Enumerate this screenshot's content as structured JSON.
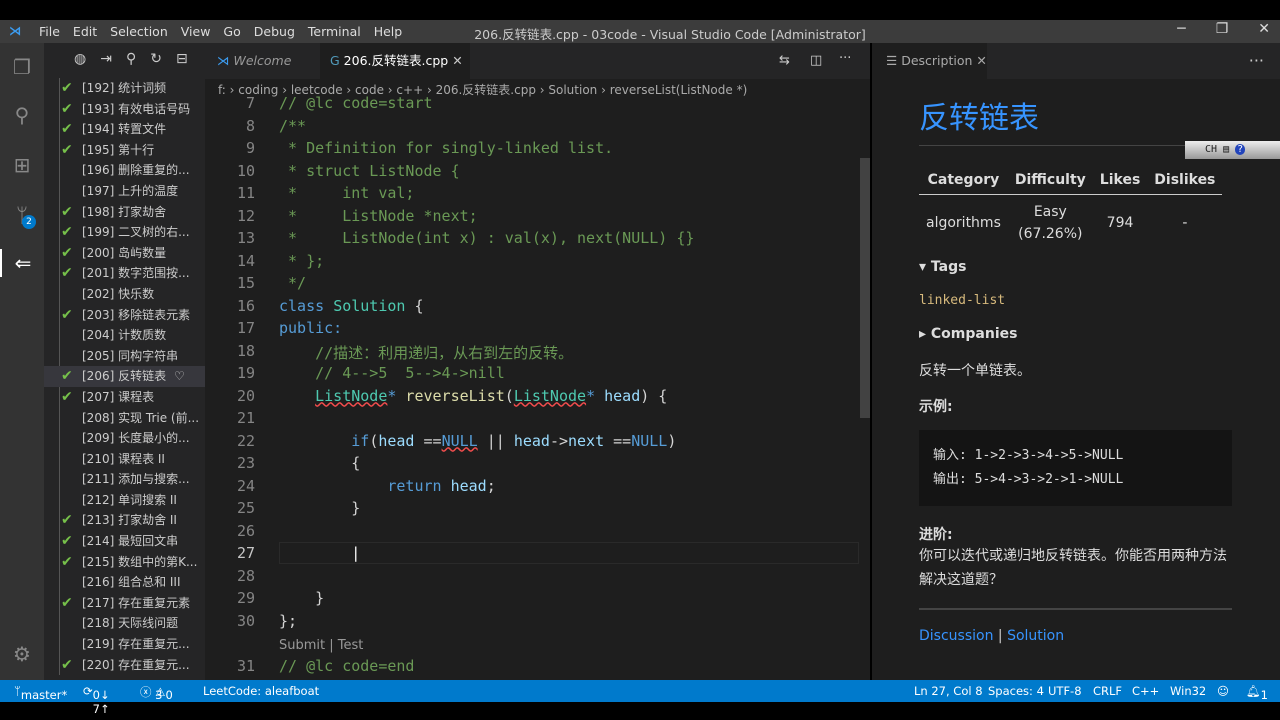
{
  "window": {
    "title": "206.反转链表.cpp - 03code - Visual Studio Code [Administrator]",
    "menu": [
      "File",
      "Edit",
      "Selection",
      "View",
      "Go",
      "Debug",
      "Terminal",
      "Help"
    ]
  },
  "activity": {
    "scm_badge": "2"
  },
  "sidebar": {
    "items": [
      {
        "label": "[192] 统计词频",
        "solved": true
      },
      {
        "label": "[193] 有效电话号码",
        "solved": true
      },
      {
        "label": "[194] 转置文件",
        "solved": true
      },
      {
        "label": "[195] 第十行",
        "solved": true
      },
      {
        "label": "[196] 删除重复的...",
        "solved": false
      },
      {
        "label": "[197] 上升的温度",
        "solved": false
      },
      {
        "label": "[198] 打家劫舍",
        "solved": true
      },
      {
        "label": "[199] 二叉树的右...",
        "solved": true
      },
      {
        "label": "[200] 岛屿数量",
        "solved": true
      },
      {
        "label": "[201] 数字范围按...",
        "solved": true
      },
      {
        "label": "[202] 快乐数",
        "solved": false
      },
      {
        "label": "[203] 移除链表元素",
        "solved": true
      },
      {
        "label": "[204] 计数质数",
        "solved": false
      },
      {
        "label": "[205] 同构字符串",
        "solved": false
      },
      {
        "label": "[206] 反转链表",
        "solved": true,
        "selected": true
      },
      {
        "label": "[207] 课程表",
        "solved": true
      },
      {
        "label": "[208] 实现 Trie (前...",
        "solved": false
      },
      {
        "label": "[209] 长度最小的...",
        "solved": false
      },
      {
        "label": "[210] 课程表 II",
        "solved": false
      },
      {
        "label": "[211] 添加与搜索...",
        "solved": false
      },
      {
        "label": "[212] 单词搜索 II",
        "solved": false
      },
      {
        "label": "[213] 打家劫舍 II",
        "solved": true
      },
      {
        "label": "[214] 最短回文串",
        "solved": true
      },
      {
        "label": "[215] 数组中的第K...",
        "solved": true
      },
      {
        "label": "[216] 组合总和 III",
        "solved": false
      },
      {
        "label": "[217] 存在重复元素",
        "solved": true
      },
      {
        "label": "[218] 天际线问题",
        "solved": false
      },
      {
        "label": "[219] 存在重复元...",
        "solved": false
      },
      {
        "label": "[220] 存在重复元...",
        "solved": true
      }
    ]
  },
  "editor": {
    "tabs": [
      {
        "label": "Welcome"
      },
      {
        "label": "206.反转链表.cpp"
      }
    ],
    "breadcrumb": [
      "f:",
      "coding",
      "leetcode",
      "code",
      "c++",
      "206.反转链表.cpp",
      "Solution",
      "reverseList(ListNode *)"
    ],
    "codelens": "Submit | Test",
    "lines": [
      {
        "n": "7",
        "tokens": [
          [
            "// @lc code=start",
            "c"
          ]
        ]
      },
      {
        "n": "8",
        "tokens": [
          [
            "/**",
            "c"
          ]
        ]
      },
      {
        "n": "9",
        "tokens": [
          [
            " * Definition for singly-linked list.",
            "c"
          ]
        ]
      },
      {
        "n": "10",
        "tokens": [
          [
            " * struct ListNode {",
            "c"
          ]
        ]
      },
      {
        "n": "11",
        "tokens": [
          [
            " *     int val;",
            "c"
          ]
        ]
      },
      {
        "n": "12",
        "tokens": [
          [
            " *     ListNode *next;",
            "c"
          ]
        ]
      },
      {
        "n": "13",
        "tokens": [
          [
            " *     ListNode(int x) : val(x), next(NULL) {}",
            "c"
          ]
        ]
      },
      {
        "n": "14",
        "tokens": [
          [
            " * };",
            "c"
          ]
        ]
      },
      {
        "n": "15",
        "tokens": [
          [
            " */",
            "c"
          ]
        ]
      },
      {
        "n": "16",
        "tokens": [
          [
            "class ",
            "k"
          ],
          [
            "Solution",
            "t"
          ],
          [
            " {",
            "p"
          ]
        ]
      },
      {
        "n": "17",
        "tokens": [
          [
            "public:",
            "k"
          ]
        ]
      },
      {
        "n": "18",
        "tokens": [
          [
            "    //描述：利用递归，从右到左的反转。",
            "c"
          ]
        ]
      },
      {
        "n": "19",
        "tokens": [
          [
            "    // 4-->5  5-->4->nill",
            "c"
          ]
        ]
      },
      {
        "n": "20",
        "tokens": [
          [
            "    ",
            "p"
          ],
          [
            "ListNode",
            "t sq"
          ],
          [
            "*",
            "k"
          ],
          [
            " reverseList",
            "f"
          ],
          [
            "(",
            "p"
          ],
          [
            "ListNode",
            "t sq"
          ],
          [
            "*",
            "k"
          ],
          [
            " head",
            "v"
          ],
          [
            ") {",
            "p"
          ]
        ]
      },
      {
        "n": "21",
        "tokens": []
      },
      {
        "n": "22",
        "tokens": [
          [
            "        if",
            "k"
          ],
          [
            "(",
            "p"
          ],
          [
            "head",
            "v"
          ],
          [
            " ==",
            "p"
          ],
          [
            "NULL",
            "k sq"
          ],
          [
            " || ",
            "p"
          ],
          [
            "head",
            "v"
          ],
          [
            "->",
            "p"
          ],
          [
            "next",
            "v"
          ],
          [
            " ==",
            "p"
          ],
          [
            "NULL",
            "k"
          ],
          [
            ")",
            "p"
          ]
        ]
      },
      {
        "n": "23",
        "tokens": [
          [
            "        {",
            "p"
          ]
        ]
      },
      {
        "n": "24",
        "tokens": [
          [
            "            return",
            "k"
          ],
          [
            " head",
            "v"
          ],
          [
            ";",
            "p"
          ]
        ]
      },
      {
        "n": "25",
        "tokens": [
          [
            "        }",
            "p"
          ]
        ]
      },
      {
        "n": "26",
        "tokens": []
      },
      {
        "n": "27",
        "tokens": [
          [
            "        ",
            "p"
          ]
        ]
      },
      {
        "n": "28",
        "tokens": []
      },
      {
        "n": "29",
        "tokens": [
          [
            "    }",
            "p"
          ]
        ]
      },
      {
        "n": "30",
        "tokens": [
          [
            "};",
            "p"
          ]
        ]
      },
      {
        "n": "31",
        "tokens": [
          [
            "// @lc code=end",
            "c"
          ]
        ]
      }
    ]
  },
  "panel": {
    "tab": "Description",
    "title": "反转链表",
    "headers": [
      "Category",
      "Difficulty",
      "Likes",
      "Dislikes"
    ],
    "row": {
      "category": "algorithms",
      "difficulty": "Easy",
      "rate": "(67.26%)",
      "likes": "794",
      "dislikes": "-"
    },
    "tags_label": "Tags",
    "tag": "linked-list",
    "companies_label": "Companies",
    "summary": "反转一个单链表。",
    "example_label": "示例:",
    "example": [
      "输入: 1->2->3->4->5->NULL",
      "输出: 5->4->3->2->1->NULL"
    ],
    "advanced_label": "进阶:",
    "advanced": "你可以迭代或递归地反转链表。你能否用两种方法解决这道题？",
    "discussion": "Discussion",
    "solution": "Solution",
    "sep": "|",
    "ime": "CH"
  },
  "status": {
    "branch": "master*",
    "sync": "0↓ 7↑",
    "errors": "3",
    "warnings": "0",
    "leetcode": "LeetCode: aleafboat",
    "position": "Ln 27, Col 8",
    "spaces": "Spaces: 4",
    "encoding": "UTF-8",
    "eol": "CRLF",
    "lang": "C++",
    "platform": "Win32",
    "bell": "1"
  },
  "colors": {
    "accent": "#007acc",
    "link": "#3794ff",
    "check": "#76c04a"
  }
}
